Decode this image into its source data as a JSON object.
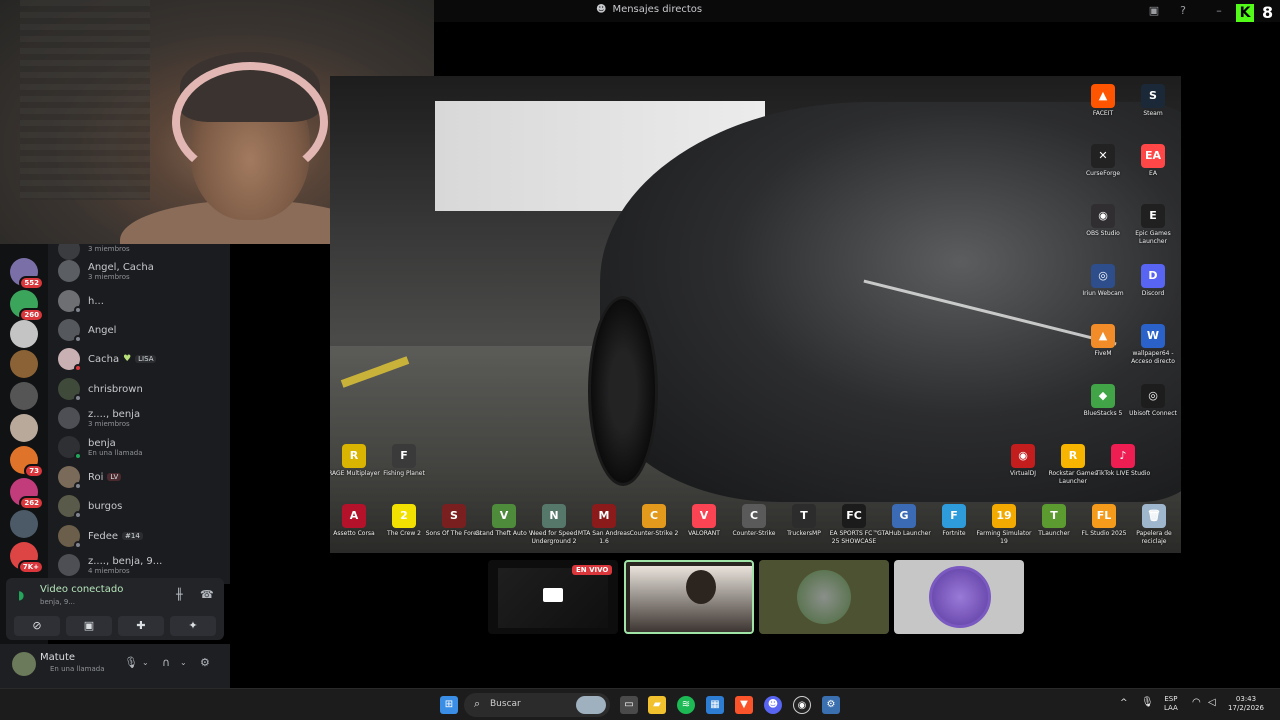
{
  "window": {
    "title": "Mensajes directos",
    "brand_k": "K",
    "brand_8": "8"
  },
  "rail": {
    "badges": [
      "552",
      "260",
      "73",
      "262",
      "7K+"
    ]
  },
  "dm_list": {
    "items": [
      {
        "name": "",
        "sub": "3 miembros"
      },
      {
        "name": "Angel, Cacha",
        "sub": "3 miembros"
      },
      {
        "name": "h...",
        "sub": ""
      },
      {
        "name": "Angel",
        "sub": ""
      },
      {
        "name": "Cacha",
        "tag": "LISA",
        "sub": ""
      },
      {
        "name": "chrisbrown",
        "sub": ""
      },
      {
        "name": "z...., benja",
        "sub": "3 miembros"
      },
      {
        "name": "benja",
        "sub": "En una llamada"
      },
      {
        "name": "Roi",
        "tag": "LV",
        "sub": ""
      },
      {
        "name": "burgos",
        "sub": ""
      },
      {
        "name": "Fedee",
        "tag": "#14",
        "sub": ""
      },
      {
        "name": "z...., benja, 9...",
        "sub": "4 miembros"
      }
    ]
  },
  "voice_panel": {
    "status": "Video conectado",
    "sub": "benja, 9..."
  },
  "user_panel": {
    "name": "Matute",
    "status": "En una llamada"
  },
  "desktop_icons": [
    {
      "label": "FACEIT",
      "color": "#ff5500",
      "glyph": "▲"
    },
    {
      "label": "Steam",
      "color": "#1b2838",
      "glyph": "S"
    },
    {
      "label": "CurseForge",
      "color": "#222222",
      "glyph": "✕"
    },
    {
      "label": "EA",
      "color": "#ff4747",
      "glyph": "EA"
    },
    {
      "label": "OBS Studio",
      "color": "#302e31",
      "glyph": "◉"
    },
    {
      "label": "Epic Games Launcher",
      "color": "#202020",
      "glyph": "E"
    },
    {
      "label": "Iriun Webcam",
      "color": "#2d4e8a",
      "glyph": "◎"
    },
    {
      "label": "Discord",
      "color": "#5865f2",
      "glyph": "D"
    },
    {
      "label": "FiveM",
      "color": "#f28c28",
      "glyph": "▲"
    },
    {
      "label": "wallpaper64 - Acceso directo",
      "color": "#2a62c9",
      "glyph": "W"
    },
    {
      "label": "BlueStacks 5",
      "color": "#41a447",
      "glyph": "◆"
    },
    {
      "label": "Ubisoft Connect",
      "color": "#1d1d1d",
      "glyph": "◎"
    },
    {
      "label": "RAGE Multiplayer",
      "color": "#d9b400",
      "glyph": "R"
    },
    {
      "label": "Fishing Planet",
      "color": "#3a3a3a",
      "glyph": "F"
    },
    {
      "label": "VirtualDJ",
      "color": "#c31d1d",
      "glyph": "◉"
    },
    {
      "label": "Rockstar Games Launcher",
      "color": "#f7b500",
      "glyph": "R"
    },
    {
      "label": "TikTok LIVE Studio",
      "color": "#ee1d52",
      "glyph": "♪"
    },
    {
      "label": "Assetto Corsa",
      "color": "#b3122a",
      "glyph": "A"
    },
    {
      "label": "The Crew 2",
      "color": "#f2e100",
      "glyph": "2"
    },
    {
      "label": "Sons Of The Forest",
      "color": "#7a1f1f",
      "glyph": "S"
    },
    {
      "label": "Grand Theft Auto V",
      "color": "#4e8b3a",
      "glyph": "V"
    },
    {
      "label": "Need for Speed Underground 2",
      "color": "#56786b",
      "glyph": "N"
    },
    {
      "label": "MTA San Andreas 1.6",
      "color": "#8b1a1a",
      "glyph": "M"
    },
    {
      "label": "Counter-Strike 2",
      "color": "#e39a1c",
      "glyph": "C"
    },
    {
      "label": "VALORANT",
      "color": "#fa4454",
      "glyph": "V"
    },
    {
      "label": "Counter-Strike",
      "color": "#5a5a5a",
      "glyph": "C"
    },
    {
      "label": "TruckersMP",
      "color": "#2c2c2c",
      "glyph": "T"
    },
    {
      "label": "EA SPORTS FC™ 25 SHOWCASE",
      "color": "#1b1b1b",
      "glyph": "FC"
    },
    {
      "label": "GTAHub Launcher",
      "color": "#3c6bb5",
      "glyph": "G"
    },
    {
      "label": "Fortnite",
      "color": "#2e9cdb",
      "glyph": "F"
    },
    {
      "label": "Farming Simulator 19",
      "color": "#f2a900",
      "glyph": "19"
    },
    {
      "label": "TLauncher",
      "color": "#5c9b2f",
      "glyph": "T"
    },
    {
      "label": "FL Studio 2025",
      "color": "#f59b1c",
      "glyph": "FL"
    },
    {
      "label": "Papelera de reciclaje",
      "color": "#9fb7cc",
      "glyph": "🗑"
    }
  ],
  "call": {
    "live_badge": "EN VIVO"
  },
  "taskbar": {
    "search_placeholder": "Buscar",
    "lang_1": "ESP",
    "lang_2": "LAA",
    "time": "03:43",
    "date": "17/2/2026"
  },
  "colors": {
    "accent_green": "#53fc18",
    "discord_red": "#da373c"
  }
}
